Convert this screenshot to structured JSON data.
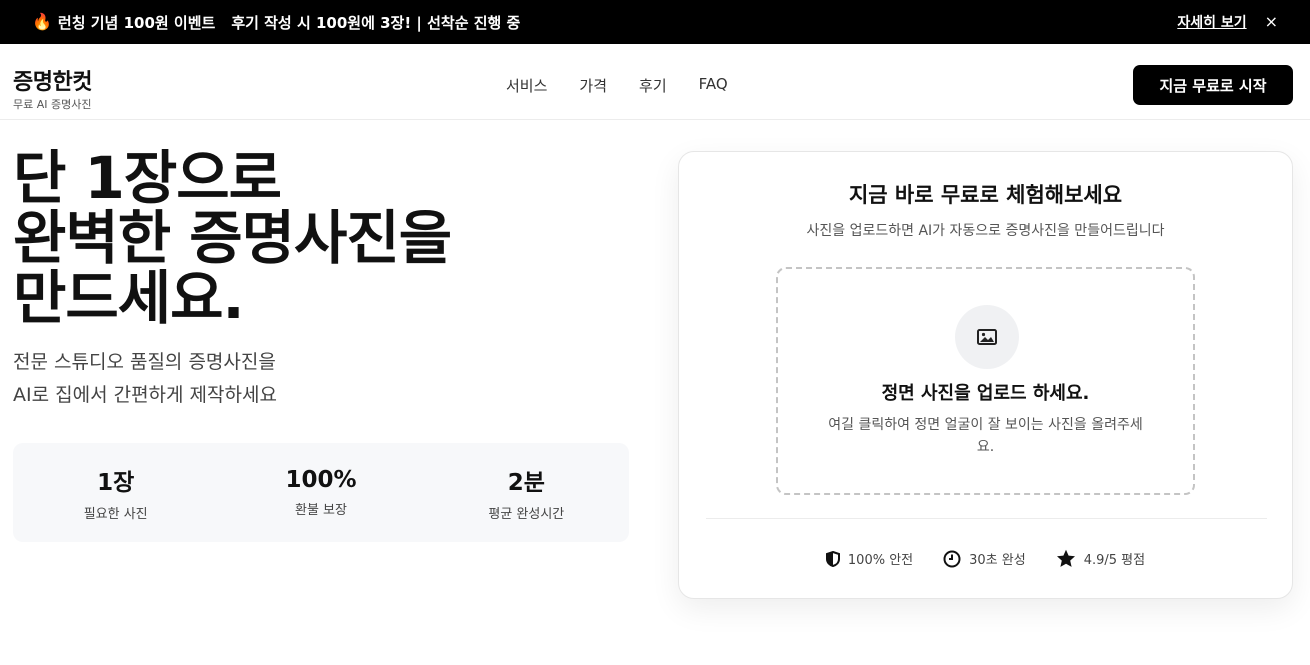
{
  "promo": {
    "icon": "fire-icon",
    "headline": "런칭 기념 100원 이벤트",
    "detail": "후기 작성 시 100원에 3장! | 선착순 진행 중",
    "link_label": "자세히 보기",
    "close_label": "×"
  },
  "header": {
    "brand_title": "증명한컷",
    "brand_sub": "무료 AI 증명사진",
    "nav": [
      "서비스",
      "가격",
      "후기",
      "FAQ"
    ],
    "cta_label": "지금 무료로 시작"
  },
  "hero": {
    "title_lines": [
      "단 1장으로",
      "완벽한 증명사진을",
      "만드세요."
    ],
    "sub_lines": [
      "전문 스튜디오 품질의 증명사진을",
      "AI로 집에서 간편하게 제작하세요"
    ],
    "stats": [
      {
        "value": "1장",
        "label": "필요한 사진"
      },
      {
        "value": "100%",
        "label": "환불 보장"
      },
      {
        "value": "2분",
        "label": "평균 완성시간"
      }
    ]
  },
  "upload_card": {
    "title": "지금 바로 무료로 체험해보세요",
    "subtitle": "사진을 업로드하면 AI가 자동으로 증명사진을 만들어드립니다",
    "dropzone_icon": "image-icon",
    "dropzone_title": "정면 사진을 업로드 하세요.",
    "dropzone_text": "여길 클릭하여 정면 얼굴이 잘 보이는 사진을 올려주세요.",
    "badges": [
      {
        "icon": "shield-icon",
        "label": "100% 안전"
      },
      {
        "icon": "clock-icon",
        "label": "30초 완성"
      },
      {
        "icon": "star-icon",
        "label": "4.9/5 평점"
      }
    ]
  },
  "colors": {
    "promo_bg": "#000000",
    "cta_bg": "#000000",
    "stats_bg": "#f7f8fa",
    "dropzone_border": "#c4c4c4"
  }
}
